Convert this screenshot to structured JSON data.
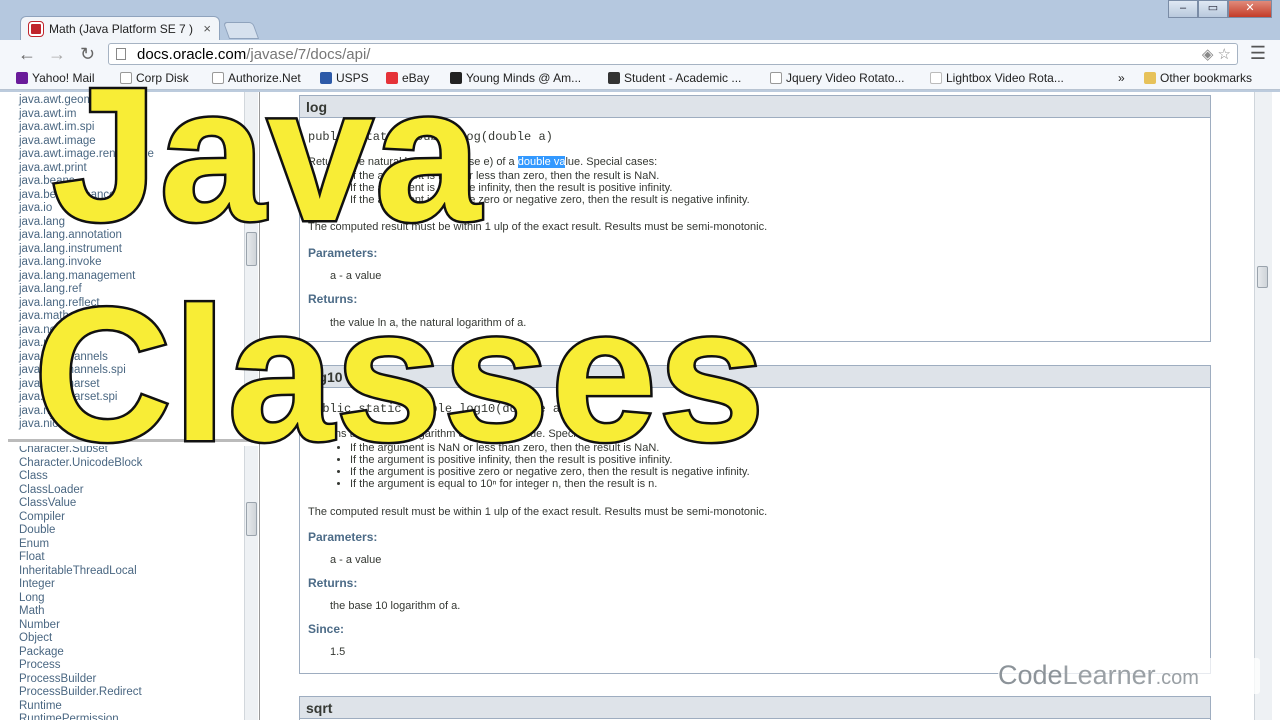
{
  "browser": {
    "tab_title": "Math (Java Platform SE 7 )",
    "tab_close": "×",
    "url_host": "docs.oracle.com",
    "url_path": "/javase/7/docs/api/",
    "nav_back": "←",
    "nav_forward": "→",
    "nav_reload": "↻",
    "omni_right_icons": "◈ ☆",
    "menu_icon": "☰",
    "window_minimize": "–",
    "window_maximize": "▭",
    "window_close": "✕"
  },
  "bookmarks": [
    {
      "label": "Yahoo! Mail",
      "color": "#6a1b9a"
    },
    {
      "label": "Corp Disk",
      "color": "#cccccc"
    },
    {
      "label": "Authorize.Net",
      "color": "#ffffff"
    },
    {
      "label": "USPS",
      "color": "#2d5aa8"
    },
    {
      "label": "eBay",
      "color": "#e53238"
    },
    {
      "label": "Young Minds @ Am...",
      "color": "#222222"
    },
    {
      "label": "Student - Academic ...",
      "color": "#333333"
    },
    {
      "label": "Jquery Video Rotato...",
      "color": "#ffffff"
    },
    {
      "label": "Lightbox Video Rota...",
      "color": "#ffffff"
    }
  ],
  "bookmarks_overflow": "»",
  "other_bookmarks": "Other bookmarks",
  "packages": [
    "java.awt.geom",
    "java.awt.im",
    "java.awt.im.spi",
    "java.awt.image",
    "java.awt.image.renderable",
    "java.awt.print",
    "java.beans",
    "java.beans.beancontext",
    "java.io",
    "java.lang",
    "java.lang.annotation",
    "java.lang.instrument",
    "java.lang.invoke",
    "java.lang.management",
    "java.lang.ref",
    "java.lang.reflect",
    "java.math",
    "java.net",
    "java.nio",
    "java.nio.channels",
    "java.nio.channels.spi",
    "java.nio.charset",
    "java.nio.charset.spi",
    "java.nio.file",
    "java.nio.file.attribute"
  ],
  "classes": [
    "Character.Subset",
    "Character.UnicodeBlock",
    "Class",
    "ClassLoader",
    "ClassValue",
    "Compiler",
    "Double",
    "Enum",
    "Float",
    "InheritableThreadLocal",
    "Integer",
    "Long",
    "Math",
    "Number",
    "Object",
    "Package",
    "Process",
    "ProcessBuilder",
    "ProcessBuilder.Redirect",
    "Runtime",
    "RuntimePermission"
  ],
  "log": {
    "heading": "log",
    "signature": "public static double log(double a)",
    "desc_before": "Returns the natural logarithm (base e) of a ",
    "desc_selected": "double va",
    "desc_after": "lue. Special cases:",
    "bullets": [
      "If the argument is NaN or less than zero, then the result is NaN.",
      "If the argument is positive infinity, then the result is positive infinity.",
      "If the argument is positive zero or negative zero, then the result is negative infinity."
    ],
    "note": "The computed result must be within 1 ulp of the exact result. Results must be semi-monotonic.",
    "params_label": "Parameters:",
    "param": "a - a value",
    "returns_label": "Returns:",
    "returns": "the value ln a, the natural logarithm of a."
  },
  "log10": {
    "heading": "log10",
    "signature": "public static double log10(double a)",
    "desc": "Returns the base 10 logarithm of a double value. Special cases:",
    "bullets": [
      "If the argument is NaN or less than zero, then the result is NaN.",
      "If the argument is positive infinity, then the result is positive infinity.",
      "If the argument is positive zero or negative zero, then the result is negative infinity.",
      "If the argument is equal to 10ⁿ for integer n, then the result is n."
    ],
    "note": "The computed result must be within 1 ulp of the exact result. Results must be semi-monotonic.",
    "params_label": "Parameters:",
    "param": "a - a value",
    "returns_label": "Returns:",
    "returns": "the base 10 logarithm of a.",
    "since_label": "Since:",
    "since": "1.5"
  },
  "sqrt": {
    "heading": "sqrt"
  },
  "overlay": {
    "line1": "Java",
    "line2": "Classes"
  },
  "watermark": {
    "code": "Code",
    "learner": "Learner",
    "dotcom": ".com"
  }
}
